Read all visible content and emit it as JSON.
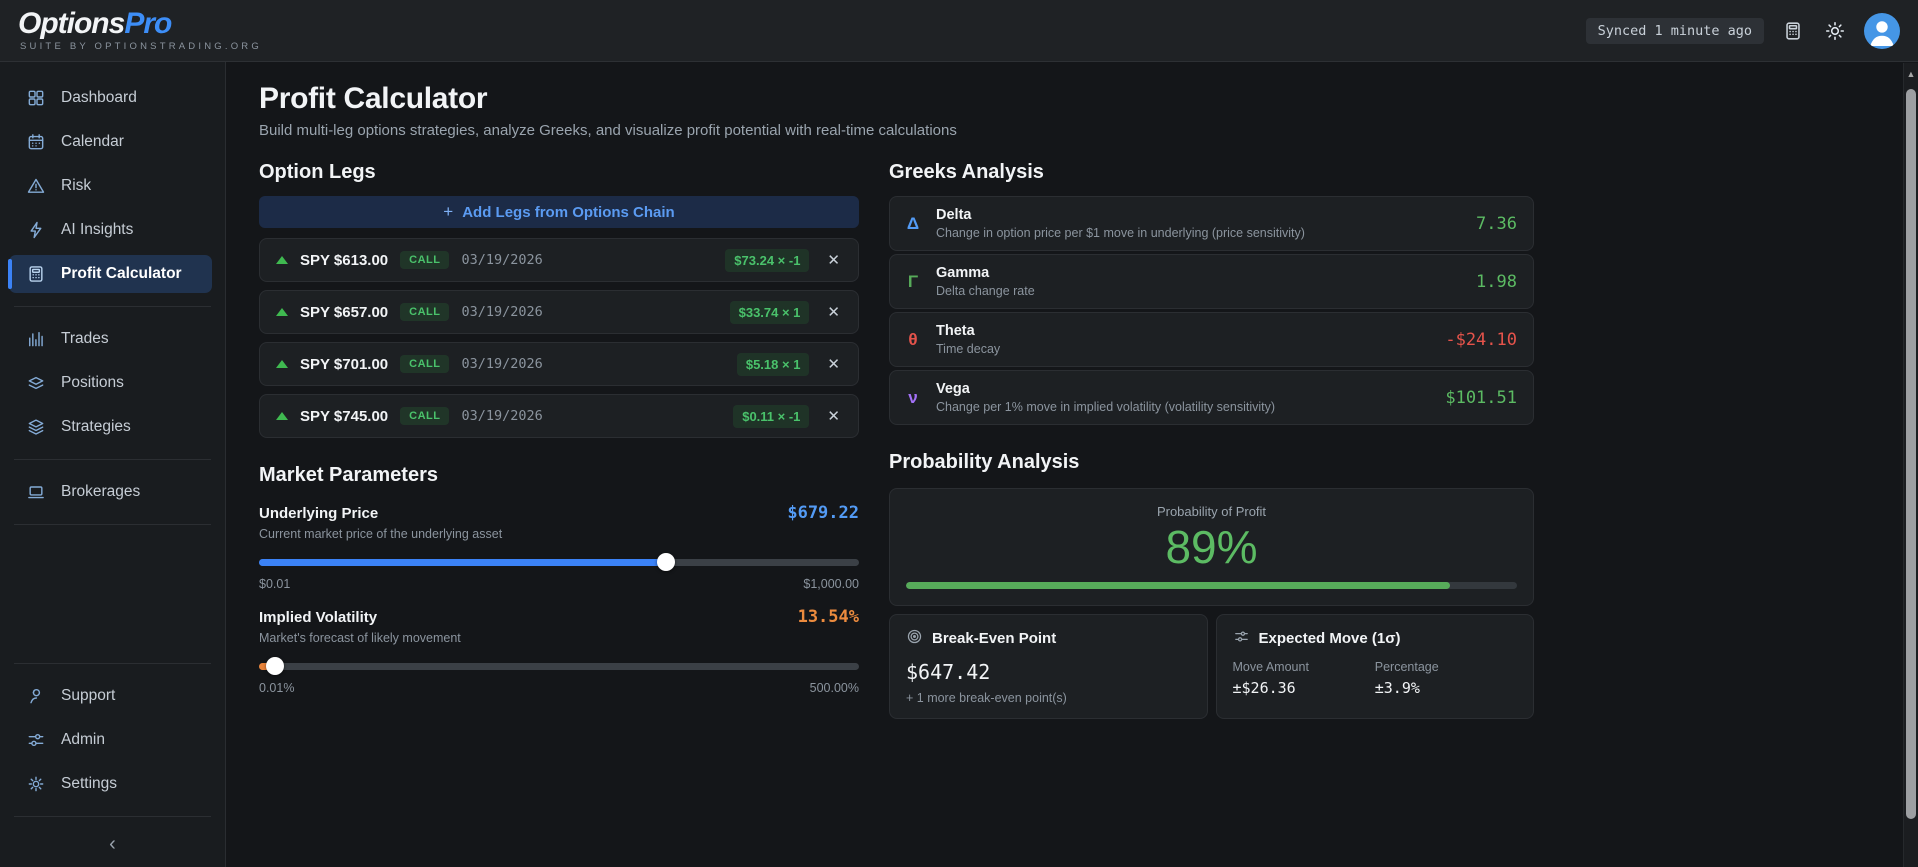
{
  "brand": {
    "name_left": "Options",
    "name_right": "Pro",
    "tagline": "SUITE BY OPTIONSTRADING.ORG"
  },
  "header": {
    "synced_status": "Synced 1 minute ago"
  },
  "icons": {
    "plus": "+",
    "close": "✕",
    "collapse": "‹",
    "scroll_up": "▲"
  },
  "colors": {
    "accent_blue": "#539bf5",
    "green": "#5cbb63",
    "red": "#e5534b",
    "purple": "#a371f7",
    "orange": "#ec8b3e"
  },
  "sidebar": {
    "items": [
      {
        "label": "Dashboard"
      },
      {
        "label": "Calendar"
      },
      {
        "label": "Risk"
      },
      {
        "label": "AI Insights"
      },
      {
        "label": "Profit Calculator"
      },
      {
        "label": "Trades"
      },
      {
        "label": "Positions"
      },
      {
        "label": "Strategies"
      },
      {
        "label": "Brokerages"
      },
      {
        "label": "Support"
      },
      {
        "label": "Admin"
      },
      {
        "label": "Settings"
      }
    ]
  },
  "page": {
    "title": "Profit Calculator",
    "subtitle": "Build multi-leg options strategies, analyze Greeks, and visualize profit potential with real-time calculations"
  },
  "option_legs": {
    "heading": "Option Legs",
    "add_button_label": "Add Legs from Options Chain",
    "legs": [
      {
        "symbol": "SPY $613.00",
        "type": "CALL",
        "expiry": "03/19/2026",
        "price": "$73.24 × -1"
      },
      {
        "symbol": "SPY $657.00",
        "type": "CALL",
        "expiry": "03/19/2026",
        "price": "$33.74 × 1"
      },
      {
        "symbol": "SPY $701.00",
        "type": "CALL",
        "expiry": "03/19/2026",
        "price": "$5.18 × 1"
      },
      {
        "symbol": "SPY $745.00",
        "type": "CALL",
        "expiry": "03/19/2026",
        "price": "$0.11 × -1"
      }
    ]
  },
  "market_parameters": {
    "heading": "Market Parameters",
    "underlying": {
      "label": "Underlying Price",
      "value": "$679.22",
      "value_color": "#539bf5",
      "fill_color": "#3b82f6",
      "description": "Current market price of the underlying asset",
      "min": "$0.01",
      "max": "$1,000.00",
      "percent": 67.9
    },
    "implied_volatility": {
      "label": "Implied Volatility",
      "value": "13.54%",
      "value_color": "#ec8b3e",
      "fill_color": "#e8833a",
      "description": "Market's forecast of likely movement",
      "min": "0.01%",
      "max": "500.00%",
      "percent": 2.7
    }
  },
  "greeks": {
    "heading": "Greeks Analysis",
    "rows": [
      {
        "symbol": "Δ",
        "symbol_color": "#539bf5",
        "name": "Delta",
        "description": "Change in option price per $1 move in underlying (price sensitivity)",
        "value": "7.36",
        "value_color": "#5cbb63"
      },
      {
        "symbol": "Γ",
        "symbol_color": "#57ab5a",
        "name": "Gamma",
        "description": "Delta change rate",
        "value": "1.98",
        "value_color": "#5cbb63"
      },
      {
        "symbol": "θ",
        "symbol_color": "#e5534b",
        "name": "Theta",
        "description": "Time decay",
        "value": "-$24.10",
        "value_color": "#e5534b"
      },
      {
        "symbol": "ν",
        "symbol_color": "#a371f7",
        "name": "Vega",
        "description": "Change per 1% move in implied volatility (volatility sensitivity)",
        "value": "$101.51",
        "value_color": "#5cbb63"
      }
    ]
  },
  "probability": {
    "heading": "Probability Analysis",
    "pop_label": "Probability of Profit",
    "pop_value": "89%",
    "pop_percent": 89,
    "break_even": {
      "title": "Break-Even Point",
      "value": "$647.42",
      "note": "+ 1 more break-even point(s)"
    },
    "expected_move": {
      "title": "Expected Move (1σ)",
      "amount_label": "Move Amount",
      "amount_value": "±$26.36",
      "percentage_label": "Percentage",
      "percentage_value": "±3.9%"
    }
  }
}
